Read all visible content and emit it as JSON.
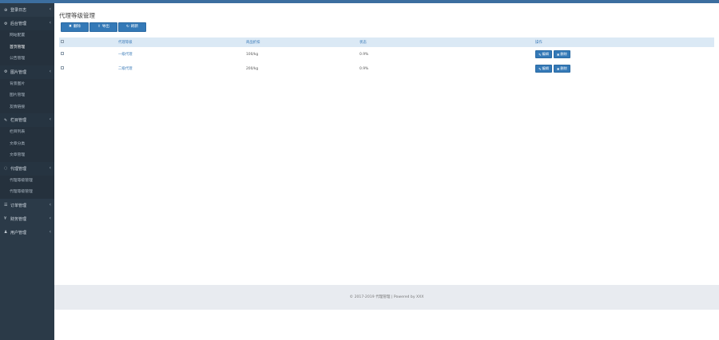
{
  "sidebar": {
    "groups": [
      {
        "label": "登录日志",
        "icon": "dashboard-icon",
        "items": []
      },
      {
        "label": "后台管理",
        "icon": "settings-icon",
        "active": true,
        "items": [
          {
            "label": "网站配置"
          },
          {
            "label": "首页管理",
            "selected": true
          },
          {
            "label": "公告管理"
          }
        ]
      },
      {
        "label": "图片管理",
        "icon": "image-icon",
        "items": [
          {
            "label": "背景图片"
          },
          {
            "label": "图片管理"
          },
          {
            "label": "友情链接"
          }
        ]
      },
      {
        "label": "栏目管理",
        "icon": "tool-icon",
        "items": [
          {
            "label": "栏目列表"
          },
          {
            "label": "文章分类"
          },
          {
            "label": "文章管理"
          }
        ]
      },
      {
        "label": "代理管理",
        "icon": "user-icon",
        "items": [
          {
            "label": "代理等级管理"
          },
          {
            "label": "代理等级管理"
          }
        ]
      },
      {
        "label": "订单管理",
        "icon": "list-icon",
        "items": []
      },
      {
        "label": "财务管理",
        "icon": "money-icon",
        "items": []
      },
      {
        "label": "用户管理",
        "icon": "person-icon",
        "items": []
      }
    ]
  },
  "main": {
    "title": "代理等级管理",
    "toolbar": {
      "delete": "删除",
      "export": "导出",
      "refresh": "刷新"
    },
    "table": {
      "headers": [
        "",
        "代理等级",
        "商品折扣",
        "状态",
        "操作"
      ],
      "rows": [
        {
          "name": "一级代理",
          "discount": "100/kg",
          "status": "0.9%",
          "edit": "编辑",
          "delete": "删除"
        },
        {
          "name": "二级代理",
          "discount": "200/kg",
          "status": "0.9%",
          "edit": "编辑",
          "delete": "删除"
        }
      ]
    },
    "footer": "© 2017-2019 代理管理 | Powered by XXX"
  },
  "colors": {
    "sidebar_bg": "#2b3a48",
    "topbar": "#3c6e9f",
    "primary_button": "#3479b7",
    "table_header_bg": "#dbe9f5",
    "footer_bg": "#e8ebf0"
  }
}
